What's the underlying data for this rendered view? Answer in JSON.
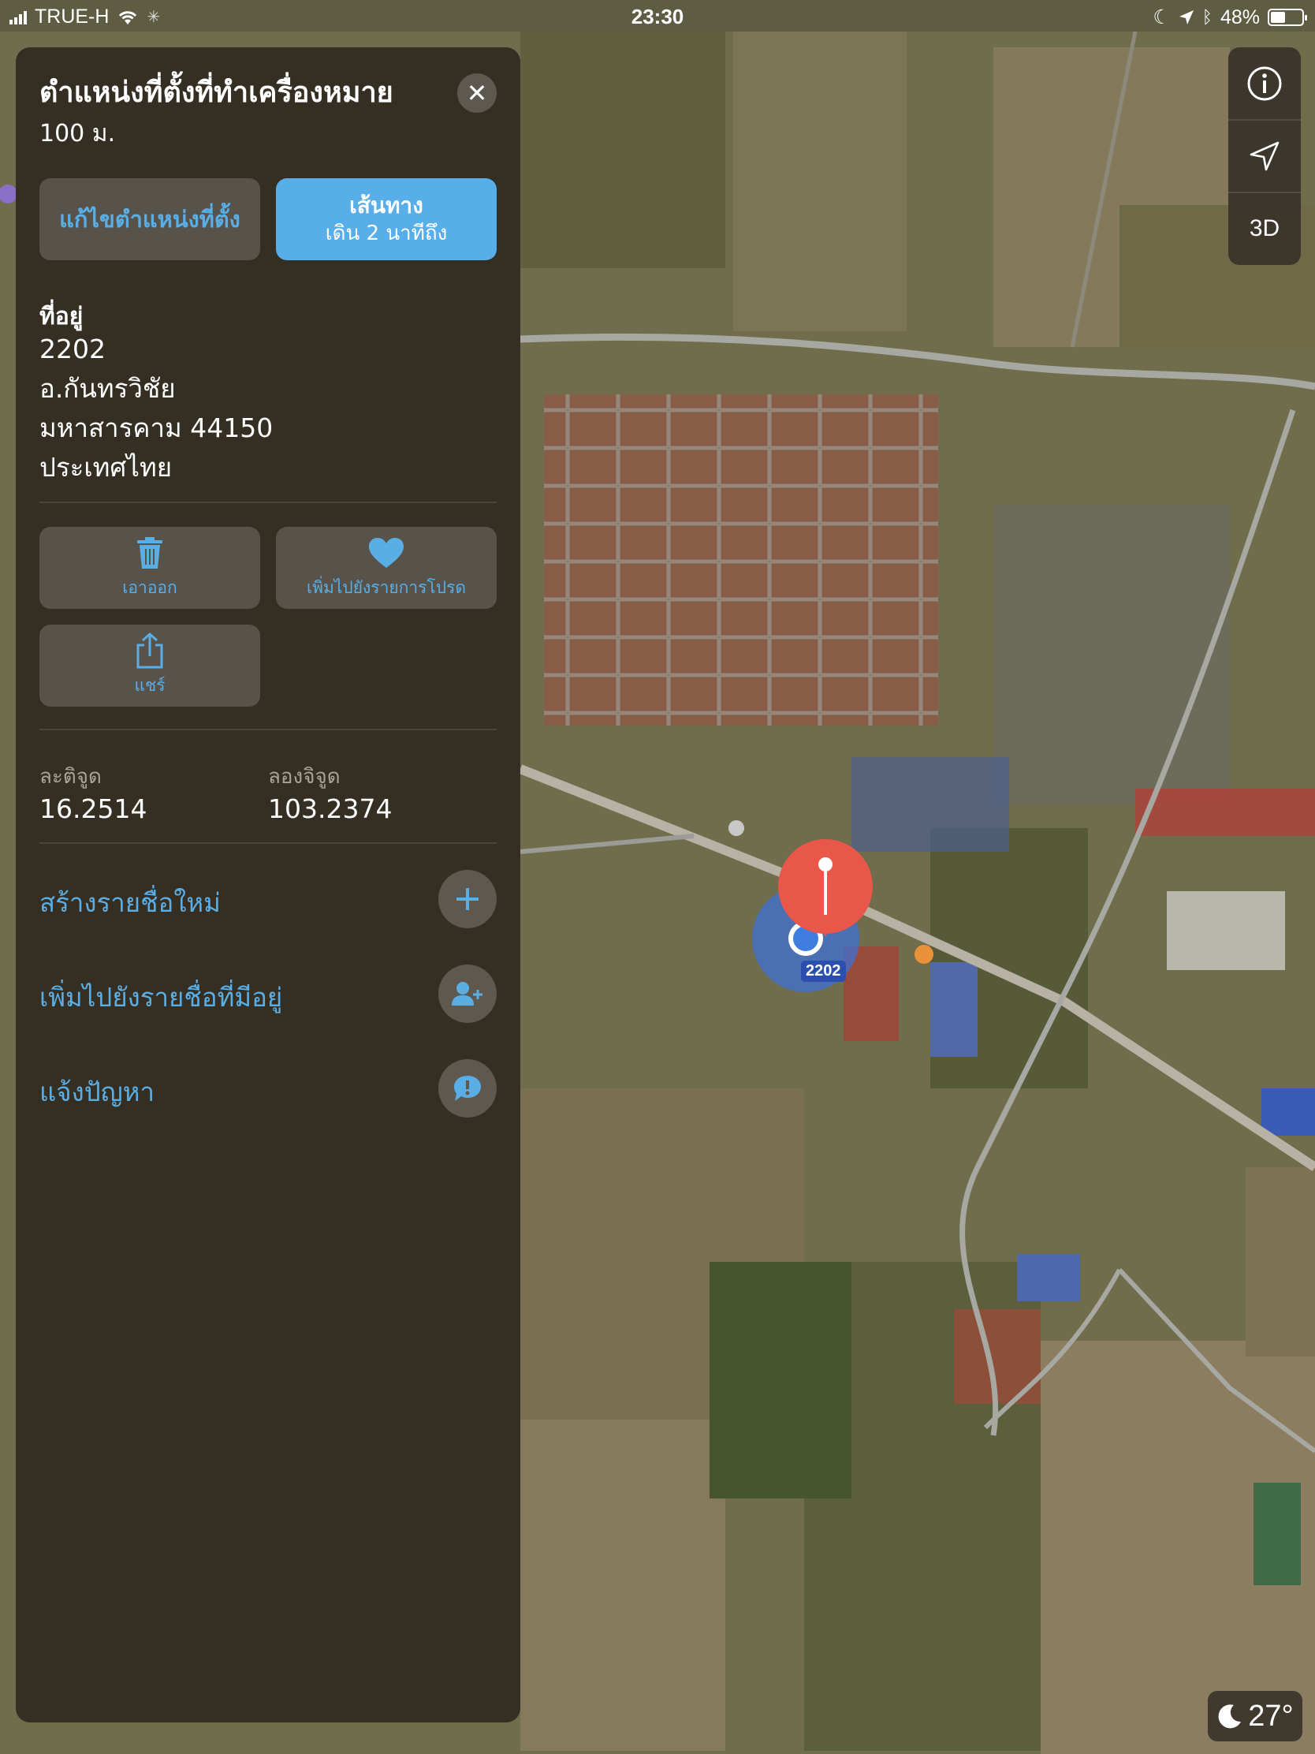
{
  "status_bar": {
    "carrier": "TRUE-H",
    "time": "23:30",
    "battery_text": "48%",
    "battery_level": 0.48
  },
  "panel": {
    "title": "ตำแหน่งที่ตั้งที่ทำเครื่องหมาย",
    "subtitle": "100 ม.",
    "edit_button": "แก้ไขตำแหน่งที่ตั้ง",
    "route_button": {
      "line1": "เส้นทาง",
      "line2": "เดิน 2 นาทีถึง"
    },
    "address": {
      "label": "ที่อยู่",
      "lines": [
        "2202",
        "อ.กันทรวิชัย",
        "มหาสารคาม 44150",
        "ประเทศไทย"
      ]
    },
    "tiles": {
      "remove": "เอาออก",
      "favorite": "เพิ่มไปยังรายการโปรด",
      "share": "แชร์"
    },
    "coordinates": {
      "lat_label": "ละติจูด",
      "lat_value": "16.2514",
      "lon_label": "ลองจิจูด",
      "lon_value": "103.2374"
    },
    "actions": {
      "new_list": "สร้างรายชื่อใหม่",
      "add_existing": "เพิ่มไปยังรายชื่อที่มีอยู่",
      "report": "แจ้งปัญหา"
    }
  },
  "controls": {
    "info_icon": "info-icon",
    "location_icon": "location-arrow-icon",
    "three_d": "3D"
  },
  "map": {
    "pin_label": "2202"
  },
  "weather": {
    "temperature": "27°",
    "icon": "moon-icon"
  },
  "colors": {
    "accent": "#59aee6",
    "pin": "#e8574a",
    "panel": "#302a20"
  }
}
